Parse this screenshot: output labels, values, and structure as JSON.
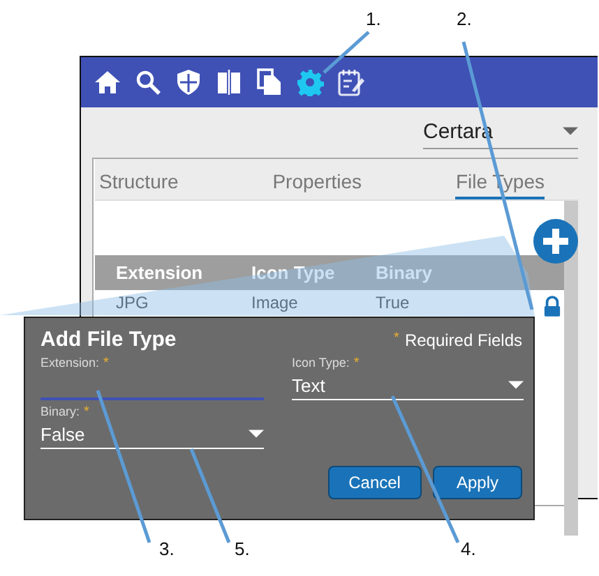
{
  "callouts": [
    "1.",
    "2.",
    "3.",
    "5.",
    "4."
  ],
  "toolbar": {
    "icons": [
      {
        "kind": "home",
        "selected": false
      },
      {
        "kind": "search",
        "selected": false
      },
      {
        "kind": "shield",
        "selected": false
      },
      {
        "kind": "compare",
        "selected": false
      },
      {
        "kind": "copy",
        "selected": false
      },
      {
        "kind": "settings",
        "selected": true
      },
      {
        "kind": "notes",
        "selected": false
      }
    ]
  },
  "tenant_select": {
    "value": "Certara"
  },
  "tabs": [
    {
      "label": "Structure",
      "selected": false
    },
    {
      "label": "Properties",
      "selected": false
    },
    {
      "label": "File Types",
      "selected": true
    }
  ],
  "table": {
    "columns": [
      "Extension",
      "Icon Type",
      "Binary"
    ],
    "rows": [
      {
        "cells": [
          "JPG",
          "Image",
          "True"
        ],
        "locked": true
      }
    ]
  },
  "dialog": {
    "title": "Add File Type",
    "required_mark": "*",
    "required_note": "Required Fields",
    "fields": [
      {
        "label": "Extension:",
        "mark": "*",
        "kind": "text",
        "focused": true
      },
      {
        "label": "Icon Type:",
        "mark": "*",
        "kind": "select",
        "value": "Text"
      },
      {
        "label": "Binary:",
        "mark": "*",
        "kind": "select",
        "value": "False"
      }
    ],
    "buttons": [
      "Cancel",
      "Apply"
    ]
  }
}
